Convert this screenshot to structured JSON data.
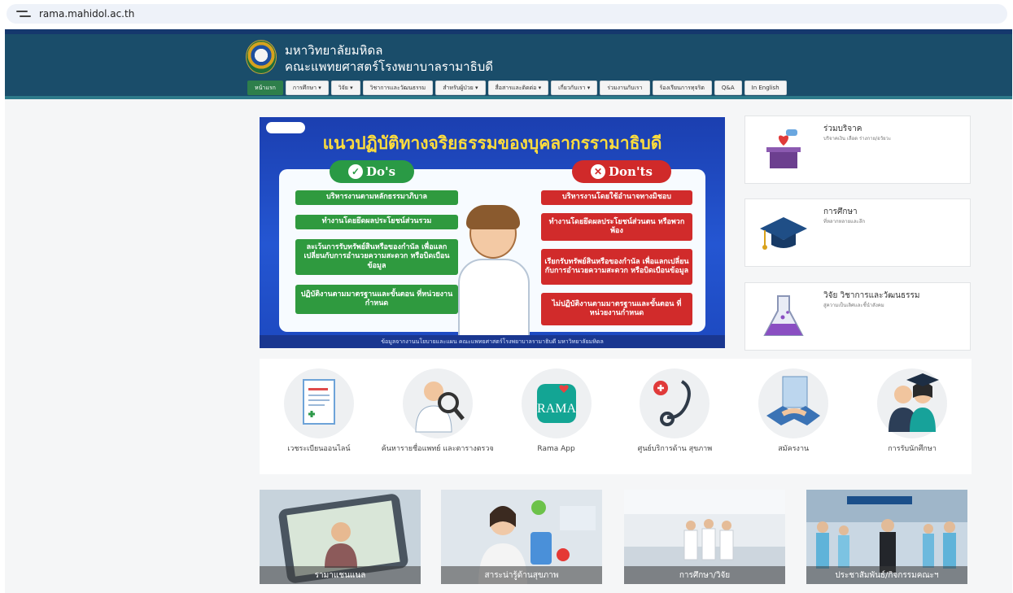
{
  "browser": {
    "url": "rama.mahidol.ac.th"
  },
  "header": {
    "university": "มหาวิทยาลัยมหิดล",
    "faculty": "คณะแพทยศาสตร์โรงพยาบาลรามาธิบดี"
  },
  "nav": {
    "items": [
      "หน้าแรก",
      "การศึกษา ▾",
      "วิจัย ▾",
      "วิชาการและวัฒนธรรม",
      "สำหรับผู้ป่วย ▾",
      "สื่อสารและติดต่อ ▾",
      "เกี่ยวกับเรา ▾",
      "ร่วมงานกับเรา",
      "ร้องเรียนการทุจริต",
      "Q&A",
      "In English"
    ]
  },
  "banner": {
    "title": "แนวปฏิบัติทางจริยธรรมของบุคลากรรามาธิบดี",
    "dos_label": "Do's",
    "donts_label": "Don'ts",
    "dos": [
      "บริหารงานตามหลักธรรมาภิบาล",
      "ทำงานโดยยึดผลประโยชน์ส่วนรวม",
      "ละเว้นการรับทรัพย์สินหรือของกำนัล เพื่อแลกเปลี่ยนกับการอำนวยความสะดวก หรือบิดเบือนข้อมูล",
      "ปฏิบัติงานตามมาตรฐานและขั้นตอน ที่หน่วยงานกำหนด"
    ],
    "donts": [
      "บริหารงานโดยใช้อำนาจทางมิชอบ",
      "ทำงานโดยยึดผลประโยชน์ส่วนตน หรือพวกพ้อง",
      "เรียกรับทรัพย์สินหรือของกำนัล เพื่อแลกเปลี่ยนกับการอำนวยความสะดวก หรือบิดเบือนข้อมูล",
      "ไม่ปฏิบัติงานตามมาตรฐานและขั้นตอน ที่หน่วยงานกำหนด"
    ],
    "footer": "ข้อมูลจากงานนโยบายและแผน คณะแพทยศาสตร์โรงพยาบาลรามาธิบดี มหาวิทยาลัยมหิดล"
  },
  "side_cards": [
    {
      "title": "ร่วมบริจาค",
      "subtitle": "บริจาคเงิน เลือด ร่างกาย/อวัยวะ"
    },
    {
      "title": "การศึกษา",
      "subtitle": "ที่หลากหลายและลึก"
    },
    {
      "title": "วิจัย วิชาการและวัฒนธรรม",
      "subtitle": "สู่ความเป็นเลิศและชี้นำสังคม"
    }
  ],
  "services": [
    "เวชระเบียนออนไลน์",
    "ค้นหารายชื่อแพทย์ และตารางตรวจ",
    "Rama App",
    "ศูนย์บริการด้าน สุขภาพ",
    "สมัครงาน",
    "การรับนักศึกษา"
  ],
  "rama_logo": "RAMA",
  "tiles": [
    "รามาแชนแนล",
    "สาระน่ารู้ด้านสุขภาพ",
    "การศึกษา/วิจัย",
    "ประชาสัมพันธ์/กิจกรรมคณะฯ"
  ],
  "colors": {
    "header_bg": "#1a4d6a",
    "nav_active": "#2e7f4b",
    "banner_blue": "#2456d2",
    "dos_green": "#2f9a3f",
    "donts_red": "#d12b2b",
    "banner_title": "#ffdd3c"
  }
}
